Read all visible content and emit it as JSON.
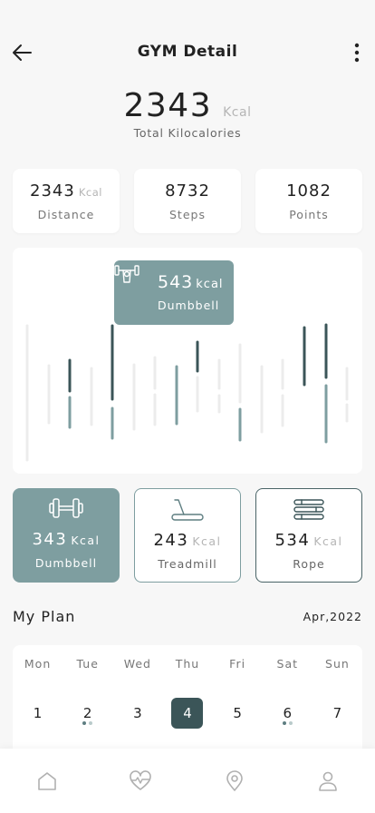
{
  "header": {
    "title": "GYM Detail",
    "back_icon": "arrow-left-icon",
    "more_icon": "more-vertical-icon"
  },
  "summary": {
    "value": "2343",
    "unit": "Kcal",
    "label": "Total Kilocalories"
  },
  "stats": [
    {
      "value": "2343",
      "unit": "Kcal",
      "label": "Distance"
    },
    {
      "value": "8732",
      "unit": "",
      "label": "Steps"
    },
    {
      "value": "1082",
      "unit": "",
      "label": "Points"
    }
  ],
  "tooltip": {
    "value": "543",
    "unit": "kcal",
    "name": "Dumbbell",
    "icon": "dumbbell-lift-icon"
  },
  "workouts": [
    {
      "value": "343",
      "unit": "Kcal",
      "name": "Dumbbell",
      "icon": "dumbbell-icon",
      "active": true
    },
    {
      "value": "243",
      "unit": "Kcal",
      "name": "Treadmill",
      "icon": "treadmill-icon",
      "active": false
    },
    {
      "value": "534",
      "unit": "Kcal",
      "name": "Rope",
      "icon": "jump-rope-icon",
      "active": false
    }
  ],
  "plan": {
    "title": "My Plan",
    "month": "Apr,2022",
    "days": [
      "Mon",
      "Tue",
      "Wed",
      "Thu",
      "Fri",
      "Sat",
      "Sun"
    ],
    "dates": [
      "1",
      "2",
      "3",
      "4",
      "5",
      "6",
      "7"
    ],
    "selected_date": "4",
    "dates_with_dots": [
      "2",
      "6"
    ]
  },
  "tabbar": [
    {
      "icon": "home-icon"
    },
    {
      "icon": "heart-pulse-icon"
    },
    {
      "icon": "map-pin-icon"
    },
    {
      "icon": "user-icon"
    }
  ],
  "colors": {
    "accent": "#7e9ea0",
    "accent_dark": "#3b5558",
    "light_bar": "#ececec",
    "mid_bar": "#7e9ea0"
  }
}
